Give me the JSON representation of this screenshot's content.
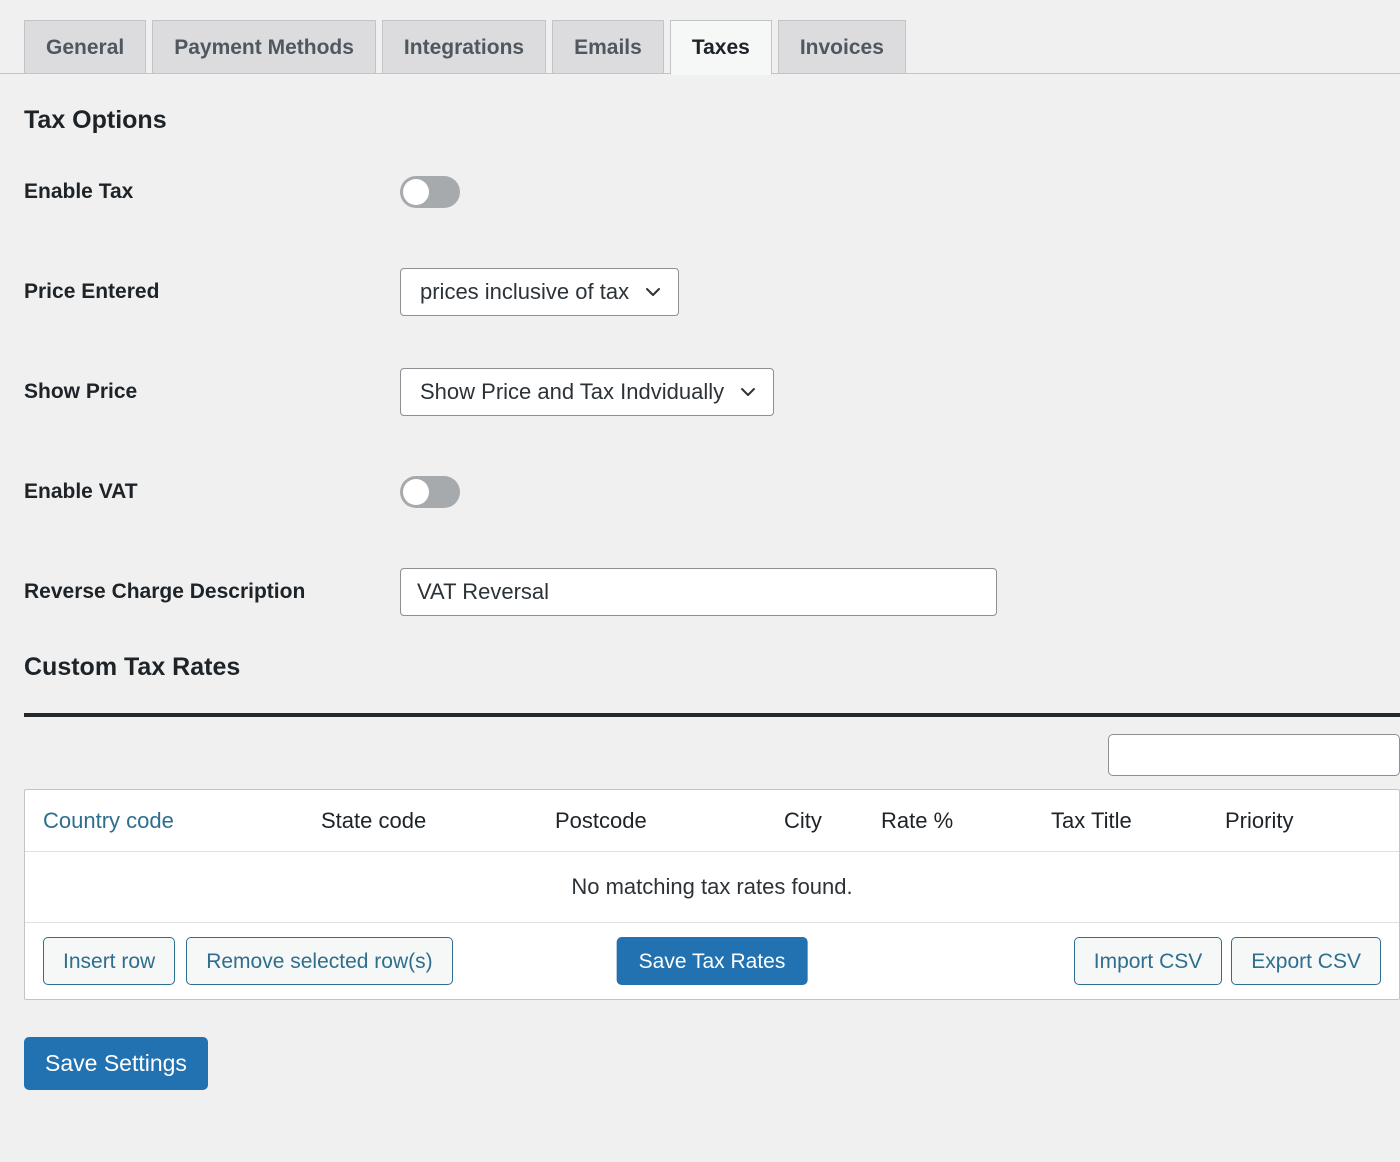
{
  "tabs": [
    {
      "label": "General",
      "active": false
    },
    {
      "label": "Payment Methods",
      "active": false
    },
    {
      "label": "Integrations",
      "active": false
    },
    {
      "label": "Emails",
      "active": false
    },
    {
      "label": "Taxes",
      "active": true
    },
    {
      "label": "Invoices",
      "active": false
    }
  ],
  "tax_options": {
    "title": "Tax Options",
    "enable_tax": {
      "label": "Enable Tax",
      "state": "off"
    },
    "price_entered": {
      "label": "Price Entered",
      "value": "prices inclusive of tax"
    },
    "show_price": {
      "label": "Show Price",
      "value": "Show Price and Tax Indvidually"
    },
    "enable_vat": {
      "label": "Enable VAT",
      "state": "off"
    },
    "reverse_charge": {
      "label": "Reverse Charge Description",
      "value": "VAT Reversal",
      "placeholder": ""
    }
  },
  "custom_tax_rates": {
    "title": "Custom Tax Rates",
    "search": {
      "value": "",
      "placeholder": ""
    },
    "columns": [
      "Country code",
      "State code",
      "Postcode",
      "City",
      "Rate %",
      "Tax Title",
      "Priority"
    ],
    "rows": [],
    "empty_message": "No matching tax rates found.",
    "actions": {
      "insert_row": "Insert row",
      "remove_selected": "Remove selected row(s)",
      "save_tax_rates": "Save Tax Rates",
      "import_csv": "Import CSV",
      "export_csv": "Export CSV"
    }
  },
  "footer": {
    "save_settings": "Save Settings"
  },
  "colors": {
    "page_background": "#f0f0f1",
    "primary": "#2271b1",
    "link": "#2e6e8e",
    "toggle_off": "#a7aaad",
    "text": "#1d2327",
    "border": "#c3c4c7"
  }
}
